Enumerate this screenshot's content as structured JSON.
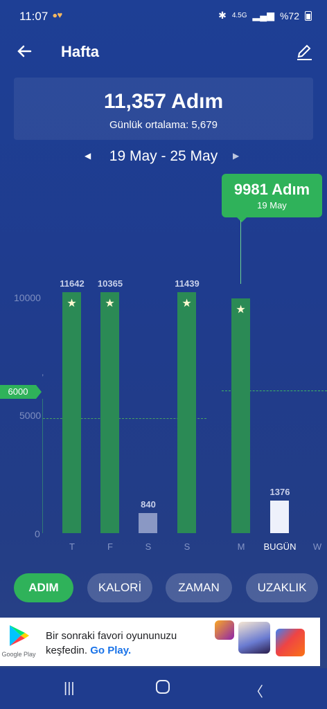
{
  "status": {
    "time": "11:07",
    "battery": "%72",
    "network": "4.5G"
  },
  "header": {
    "title": "Hafta"
  },
  "summary": {
    "total": "11,357 Adım",
    "average_label": "Günlük ortalama:",
    "average_value": "5,679"
  },
  "week": {
    "range": "19 May - 25 May"
  },
  "tooltip": {
    "value": "9981 Adım",
    "date": "19 May"
  },
  "goal": {
    "label": "6000"
  },
  "axis": {
    "y_top": "10000",
    "y_mid": "5000",
    "y_zero": "0",
    "small_mark": ","
  },
  "chart_data": {
    "type": "bar",
    "categories": [
      "T",
      "F",
      "S",
      "S",
      "M",
      "BUGÜN",
      "W"
    ],
    "values": [
      11642,
      10365,
      840,
      11439,
      9981,
      1376,
      0
    ],
    "value_labels": [
      "11642",
      "10365",
      "840",
      "11439",
      "",
      "1376",
      ""
    ],
    "ylim": [
      0,
      10000
    ],
    "goal": 6000,
    "colors": {
      "met": "#2b8a55",
      "low": "#8a98c4",
      "today": "#eef1fb"
    }
  },
  "tabs": [
    {
      "label": "ADIM",
      "active": true
    },
    {
      "label": "KALORİ",
      "active": false
    },
    {
      "label": "ZAMAN",
      "active": false
    },
    {
      "label": "UZAKLIK",
      "active": false
    }
  ],
  "ad": {
    "store_label": "Google Play",
    "line1": "Bir sonraki favori oyununuzu",
    "line2_prefix": "keşfedin.",
    "line2_link": "Go Play."
  }
}
